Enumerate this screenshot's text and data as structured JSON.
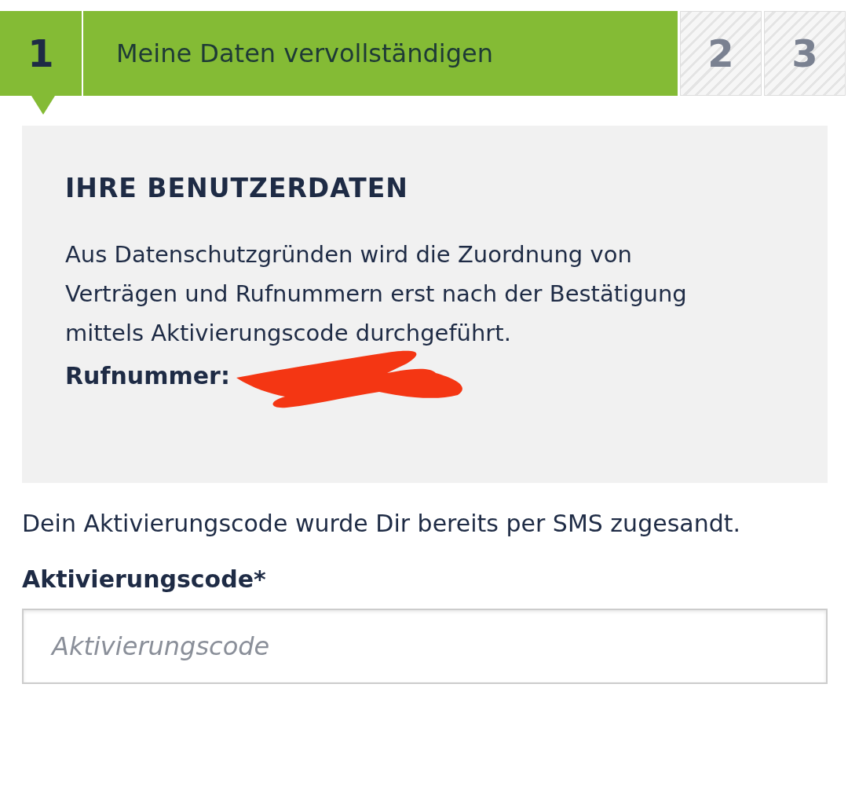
{
  "steps": [
    {
      "number": "1",
      "label": "Meine Daten vervollständigen",
      "selected": true
    },
    {
      "number": "2",
      "selected": false
    },
    {
      "number": "3",
      "selected": false
    }
  ],
  "card": {
    "heading": "IHRE BENUTZERDATEN",
    "text": "Aus Datenschutzgründen wird die Zuordnung von Verträgen und Rufnummern erst nach der Bestätigung mittels Aktivierungscode durchgeführt.",
    "phone_label": "Rufnummer:"
  },
  "info": "Dein Aktivierungscode wurde Dir bereits per SMS zugesandt.",
  "field": {
    "label": "Aktivierungscode*",
    "placeholder": "Aktivierungscode"
  }
}
